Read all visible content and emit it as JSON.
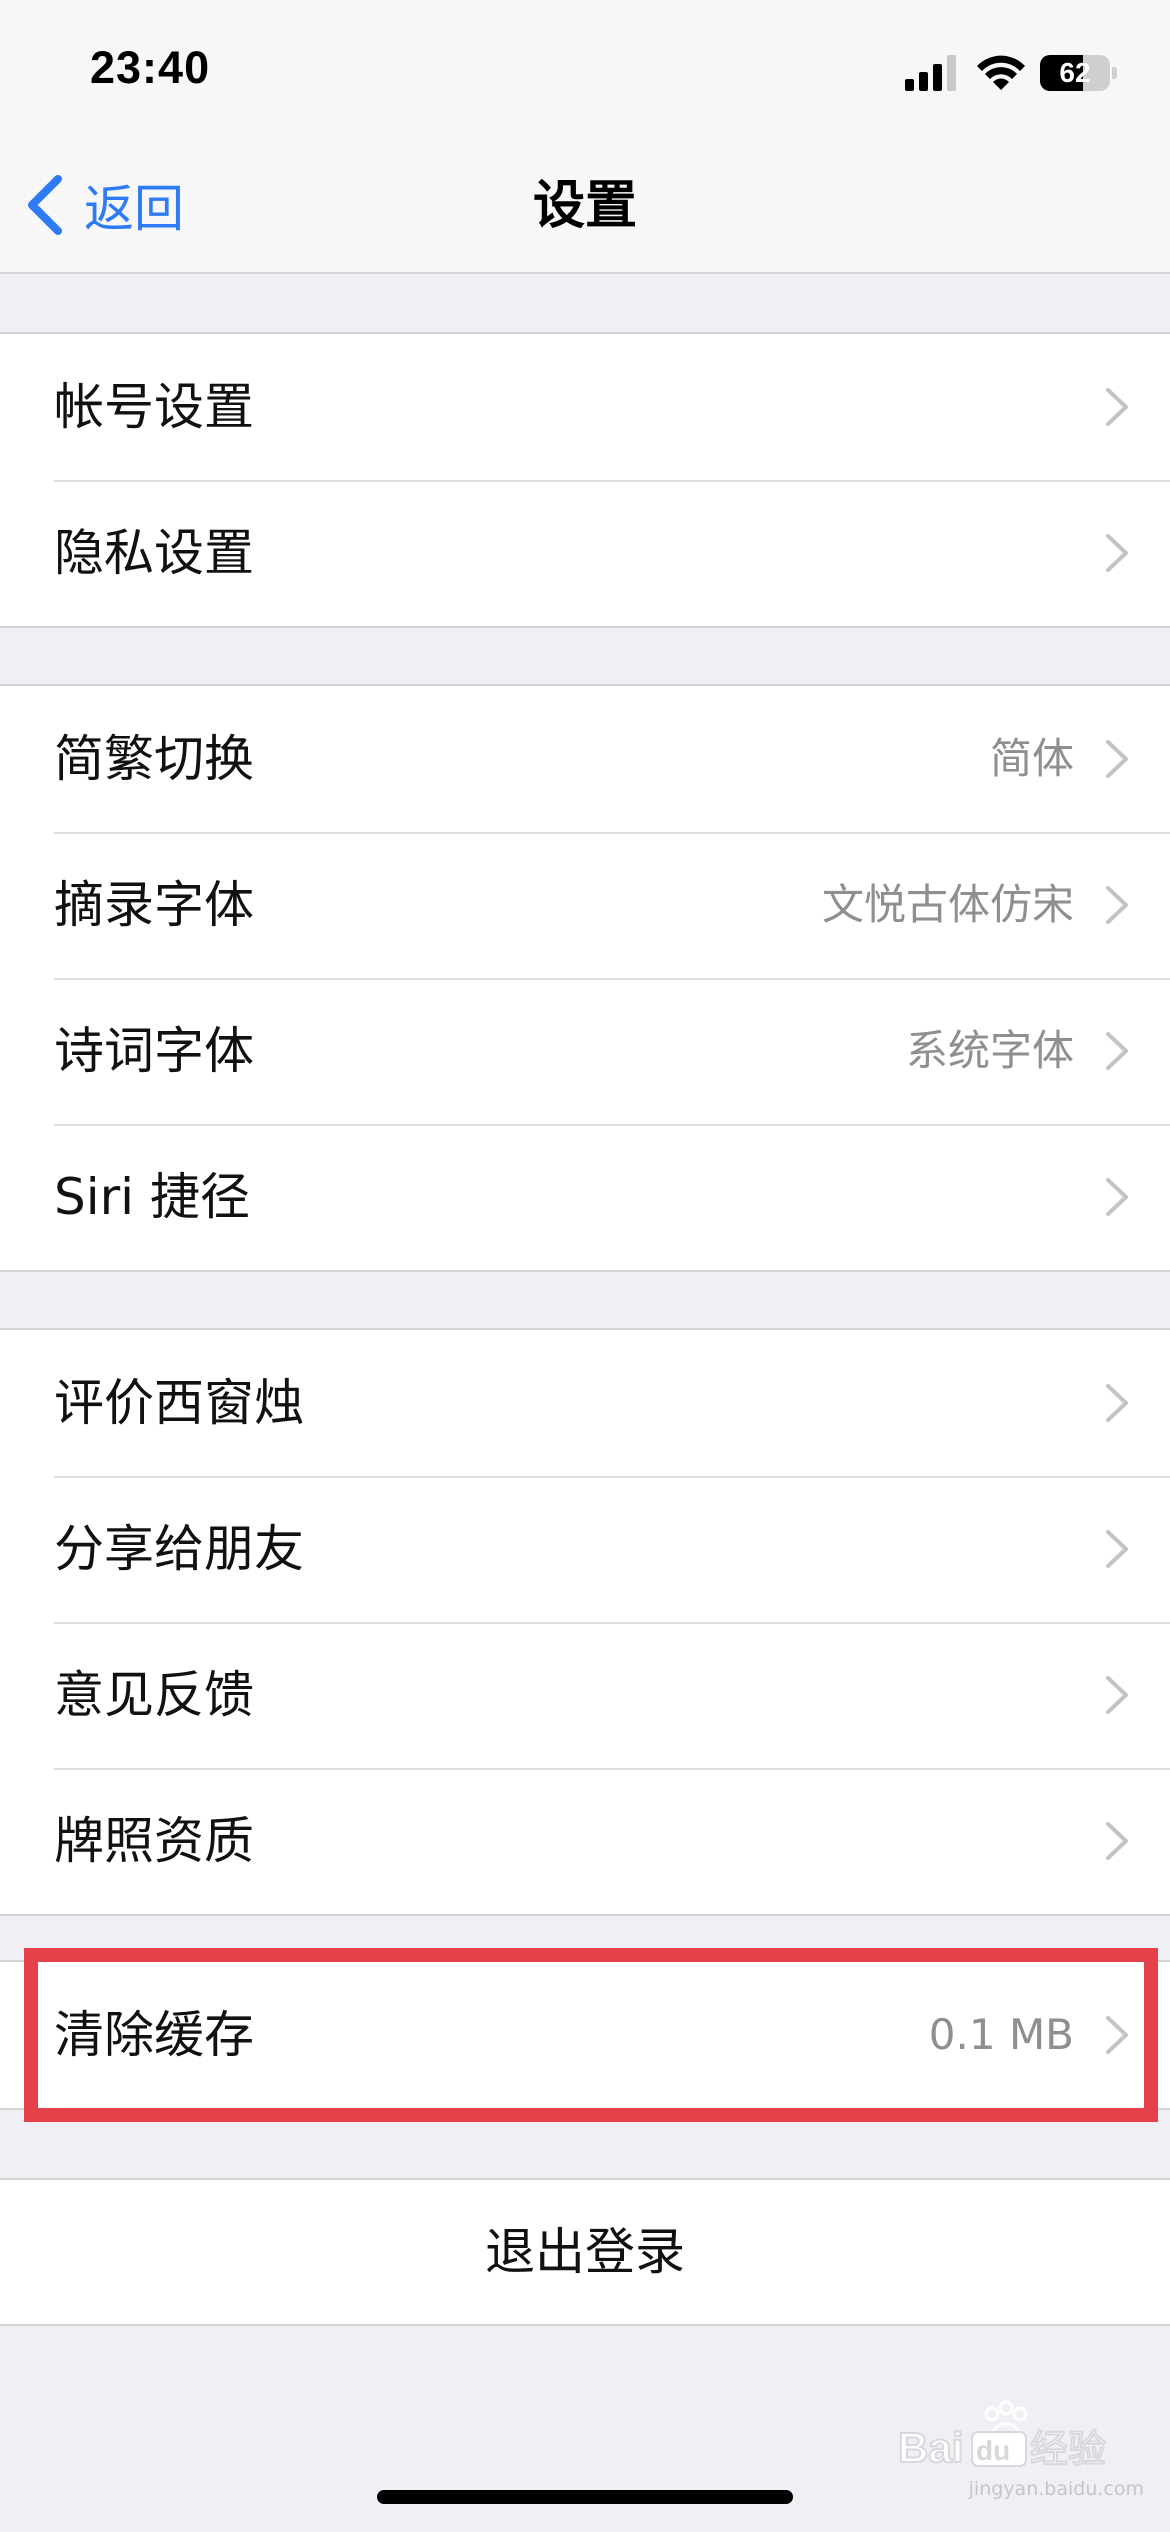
{
  "status_bar": {
    "time": "23:40",
    "signal_icon": "cellular-signal-icon",
    "wifi_icon": "wifi-icon",
    "battery_level": "62"
  },
  "nav": {
    "back_label": "返回",
    "title": "设置"
  },
  "groups": [
    {
      "rows": [
        {
          "label": "帐号设置",
          "value": ""
        },
        {
          "label": "隐私设置",
          "value": ""
        }
      ]
    },
    {
      "rows": [
        {
          "label": "简繁切换",
          "value": "简体"
        },
        {
          "label": "摘录字体",
          "value": "文悦古体仿宋"
        },
        {
          "label": "诗词字体",
          "value": "系统字体"
        },
        {
          "label": "Siri 捷径",
          "value": ""
        }
      ]
    },
    {
      "rows": [
        {
          "label": "评价西窗烛",
          "value": ""
        },
        {
          "label": "分享给朋友",
          "value": ""
        },
        {
          "label": "意见反馈",
          "value": ""
        },
        {
          "label": "牌照资质",
          "value": ""
        }
      ]
    },
    {
      "rows": [
        {
          "label": "清除缓存",
          "value": "0.1 MB"
        }
      ]
    }
  ],
  "logout": {
    "label": "退出登录"
  },
  "watermark": {
    "text": "jingyan.baidu.com"
  },
  "colors": {
    "accent": "#2f7bf6",
    "highlight": "#e5414b",
    "secondary_text": "#8e8e93",
    "background": "#efeff4"
  }
}
